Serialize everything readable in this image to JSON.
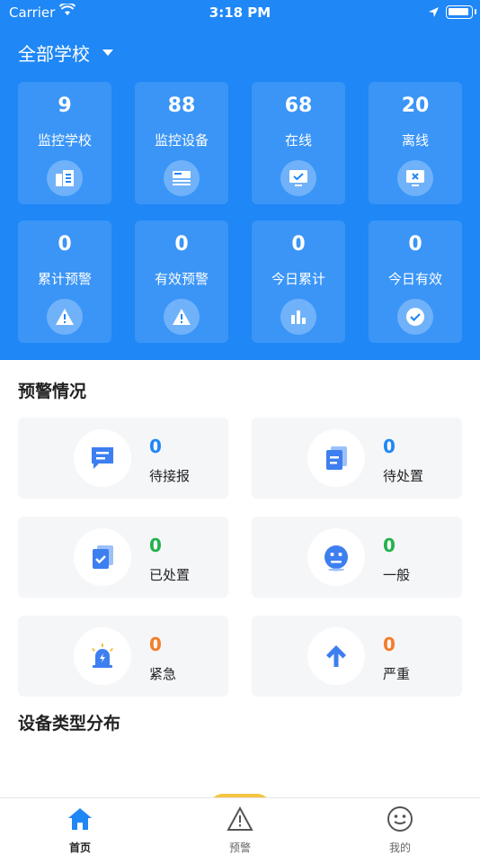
{
  "status_bar": {
    "carrier": "Carrier",
    "time": "3:18 PM"
  },
  "header": {
    "school_select": "全部学校"
  },
  "stats": [
    {
      "value": "9",
      "label": "监控学校",
      "icon": "building-icon"
    },
    {
      "value": "88",
      "label": "监控设备",
      "icon": "device-icon"
    },
    {
      "value": "68",
      "label": "在线",
      "icon": "monitor-check-icon"
    },
    {
      "value": "20",
      "label": "离线",
      "icon": "monitor-x-icon"
    },
    {
      "value": "0",
      "label": "累计预警",
      "icon": "warning-icon"
    },
    {
      "value": "0",
      "label": "有效预警",
      "icon": "warning-icon"
    },
    {
      "value": "0",
      "label": "今日累计",
      "icon": "bar-chart-icon"
    },
    {
      "value": "0",
      "label": "今日有效",
      "icon": "check-circle-icon"
    }
  ],
  "warning_section": {
    "title": "预警情况",
    "items": [
      {
        "value": "0",
        "label": "待接报",
        "icon": "chat-icon",
        "value_color": "#1f87f6"
      },
      {
        "value": "0",
        "label": "待处置",
        "icon": "document-icon",
        "value_color": "#1f87f6"
      },
      {
        "value": "0",
        "label": "已处置",
        "icon": "checked-document-icon",
        "value_color": "#22b24c"
      },
      {
        "value": "0",
        "label": "一般",
        "icon": "face-icon",
        "value_color": "#22b24c"
      },
      {
        "value": "0",
        "label": "紧急",
        "icon": "siren-icon",
        "value_color": "#f57c28"
      },
      {
        "value": "0",
        "label": "严重",
        "icon": "arrow-up-icon",
        "value_color": "#f57c28"
      }
    ]
  },
  "device_section": {
    "title": "设备类型分布"
  },
  "tabbar": {
    "tabs": [
      {
        "label": "首页",
        "icon": "home-icon",
        "active": true
      },
      {
        "label": "预警",
        "icon": "warning-triangle-icon",
        "active": false
      },
      {
        "label": "我的",
        "icon": "smile-icon",
        "active": false
      }
    ]
  },
  "colors": {
    "primary": "#1f87f6",
    "green": "#22b24c",
    "orange": "#f57c28",
    "card_bg": "#f5f6f8"
  }
}
